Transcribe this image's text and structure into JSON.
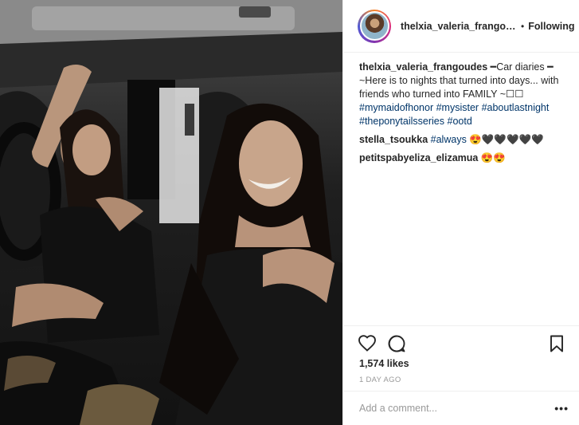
{
  "photo": {
    "alt": "Two women smiling in a car at night"
  },
  "header": {
    "username": "thelxia_valeria_frangou...",
    "separator": "•",
    "follow_status": "Following"
  },
  "comments": [
    {
      "user": "thelxia_valeria_frangoudes",
      "text": "━Car diaries ━ ~Here is to nights that turned into days... with friends who turned into FAMILY ~☐☐ ",
      "tags": [
        "#mymaidofhonor",
        "#mysister",
        "#aboutlastnight",
        "#theponytailsseries",
        "#ootd"
      ]
    },
    {
      "user": "stella_tsoukka",
      "text": "",
      "tags": [
        "#always"
      ],
      "suffix": " 😍🖤🖤🖤🖤🖤"
    },
    {
      "user": "petitspabyeliza_elizamua",
      "text": "😍😍",
      "tags": []
    }
  ],
  "actions": {
    "like_icon": "heart-icon",
    "comment_icon": "comment-bubble-icon",
    "save_icon": "bookmark-icon"
  },
  "likes": "1,574 likes",
  "timestamp": "1 DAY AGO",
  "add_comment": {
    "placeholder": "Add a comment...",
    "more": "•••"
  },
  "colors": {
    "hashtag": "#003569",
    "border": "#efefef",
    "muted": "#999999"
  }
}
